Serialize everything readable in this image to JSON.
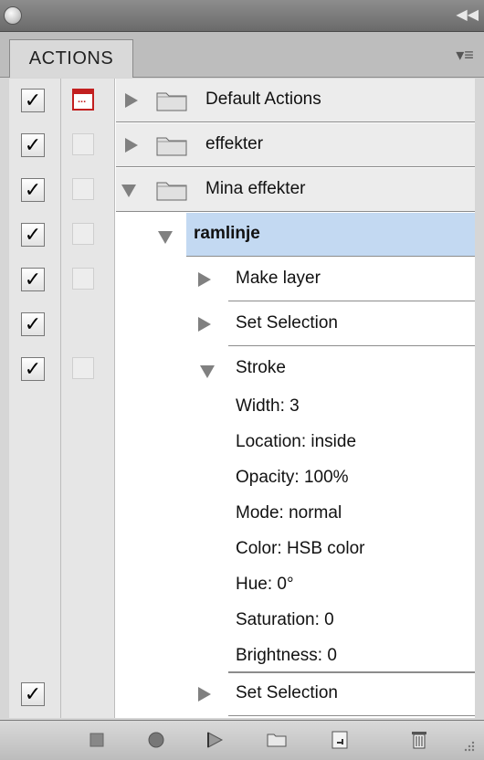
{
  "window": {
    "close_icon": "close-circle-icon",
    "collapse_icon": "double-chevron-right-icon"
  },
  "tabs": [
    {
      "label": "ACTIONS"
    }
  ],
  "panel_menu_icon": "panel-menu-icon",
  "colors": {
    "selected_row": "#c3d9f2",
    "dialog_red": "#c21f1f"
  },
  "rows": [
    {
      "name": "Default Actions",
      "type": "set",
      "expanded": false,
      "toggle": true,
      "dialog": true
    },
    {
      "name": "effekter",
      "type": "set",
      "expanded": false,
      "toggle": true,
      "dialog": false
    },
    {
      "name": "Mina effekter",
      "type": "set",
      "expanded": true,
      "toggle": true,
      "dialog": false
    },
    {
      "name": "ramlinje",
      "type": "action",
      "expanded": true,
      "selected": true,
      "toggle": true,
      "dialog": false
    },
    {
      "name": "Make layer",
      "type": "command",
      "expanded": false,
      "toggle": true,
      "dialog": false
    },
    {
      "name": "Set Selection",
      "type": "command",
      "expanded": false,
      "toggle": true,
      "dialog": null
    },
    {
      "name": "Stroke",
      "type": "command",
      "expanded": true,
      "toggle": true,
      "dialog": false,
      "details": [
        "Width: 3",
        "Location: inside",
        "Opacity: 100%",
        "Mode: normal",
        "Color: HSB color",
        "Hue: 0°",
        "Saturation: 0",
        "Brightness: 0"
      ]
    },
    {
      "name": "Set Selection",
      "type": "command",
      "expanded": false,
      "toggle": true,
      "dialog": null
    }
  ],
  "toolbar": [
    {
      "icon": "stop-icon"
    },
    {
      "icon": "record-icon"
    },
    {
      "icon": "play-icon"
    },
    {
      "icon": "new-set-folder-icon"
    },
    {
      "icon": "new-action-icon"
    },
    {
      "icon": "trash-icon"
    }
  ]
}
